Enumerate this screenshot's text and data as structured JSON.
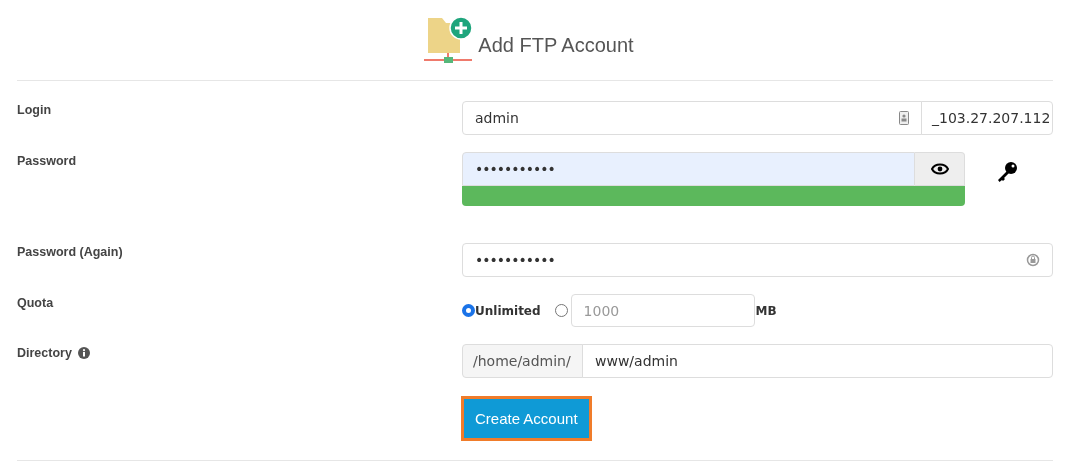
{
  "header": {
    "title": "Add FTP Account"
  },
  "login": {
    "label": "Login",
    "value": "admin",
    "domain": "_103.27.207.112"
  },
  "password": {
    "label": "Password",
    "value": "•••••••••••",
    "strength": {
      "level": 1
    }
  },
  "password_again": {
    "label": "Password (Again)",
    "value": "•••••••••••"
  },
  "quota": {
    "label": "Quota",
    "options": [
      {
        "label": "Unlimited",
        "selected": true
      },
      {
        "placeholder": "1000",
        "unit": "MB",
        "selected": false
      }
    ]
  },
  "directory": {
    "label": "Directory",
    "prefix": "/home/admin/",
    "value": "www/admin"
  },
  "submit": {
    "label": "Create Account"
  }
}
